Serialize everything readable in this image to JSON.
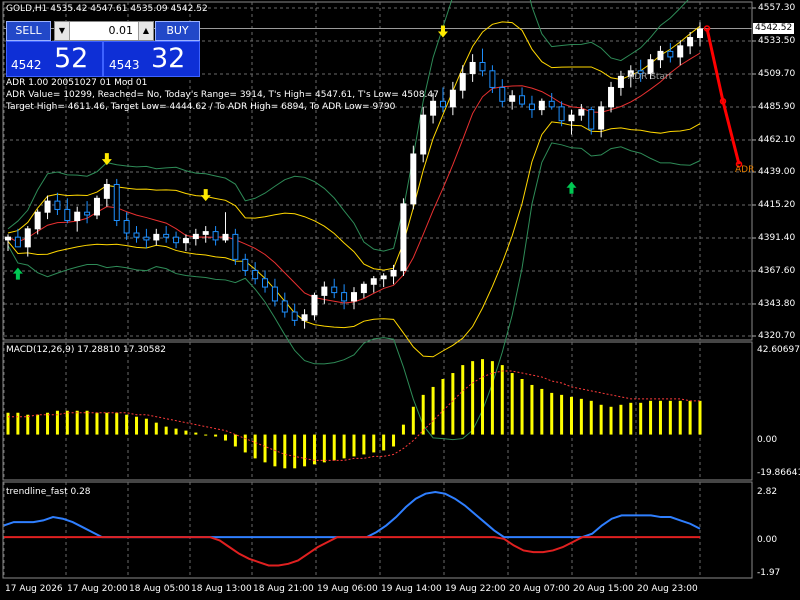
{
  "chart_header": "GOLD,H1  4535.42 4547.61 4535.09 4542.52",
  "trade_panel": {
    "sell_label": "SELL",
    "buy_label": "BUY",
    "lot": "0.01",
    "lot_down_icon": "arrow-down-icon",
    "lot_up_icon": "arrow-up-icon",
    "sell_small": "4542",
    "sell_big": "52",
    "buy_small": "4543",
    "buy_big": "32"
  },
  "adr_info": {
    "line1": "ADR 1.00 20051027 01 Mod 01",
    "line2": "ADR Value= 10299, Reached= No, Today's Range= 3914, T's High= 4547.61, T's Low= 4508.47",
    "line3": "Target High= 4611.46, Target Low= 4444.62 / To ADR High= 6894, To ADR Low= 9790"
  },
  "adr_labels": {
    "start": "ADR Start",
    "adr": "ADR"
  },
  "price_axis": {
    "ticks": [
      "4557.30",
      "4533.50",
      "4509.70",
      "4485.90",
      "4462.10",
      "4439.00",
      "4415.20",
      "4391.40",
      "4367.60",
      "4343.80",
      "4320.70"
    ],
    "current": "4542.52"
  },
  "macd": {
    "label": "MACD(12,26,9) 17.28810 17.30582",
    "ticks": [
      "42.60697",
      "0.00",
      "-19.86641"
    ]
  },
  "trendline": {
    "label": "trendline_fast 0.28",
    "ticks": [
      "2.82",
      "0.00",
      "-1.97"
    ]
  },
  "time_axis": [
    "17 Aug 2026",
    "17 Aug 20:00",
    "18 Aug 05:00",
    "18 Aug 13:00",
    "18 Aug 21:00",
    "19 Aug 06:00",
    "19 Aug 14:00",
    "19 Aug 22:00",
    "20 Aug 07:00",
    "20 Aug 15:00",
    "20 Aug 23:00"
  ],
  "colors": {
    "bull": "#ffffff",
    "bear": "#1e90ff",
    "macd_hist": "#ffff00",
    "macd_signal": "#ff3b3b",
    "bands": "#2e8b57",
    "inner_band": "#ffd700",
    "mid": "#e83030",
    "trend_blue": "#2f7fff",
    "trend_red": "#e02020",
    "adr_projection": "#ff0000",
    "grid": "#6a6a6a",
    "arrow_up": "#00c853",
    "arrow_down": "#ffea00"
  },
  "chart_data": {
    "type": "candlestick",
    "price_range": [
      4320.7,
      4557.3
    ],
    "last_price": 4542.52,
    "candles": [
      [
        4390,
        4394,
        4382,
        4392
      ],
      [
        4392,
        4398,
        4386,
        4385
      ],
      [
        4385,
        4400,
        4378,
        4398
      ],
      [
        4398,
        4412,
        4394,
        4410
      ],
      [
        4410,
        4422,
        4405,
        4418
      ],
      [
        4418,
        4424,
        4408,
        4412
      ],
      [
        4412,
        4420,
        4402,
        4404
      ],
      [
        4404,
        4414,
        4396,
        4410
      ],
      [
        4410,
        4418,
        4402,
        4408
      ],
      [
        4408,
        4422,
        4405,
        4420
      ],
      [
        4420,
        4434,
        4414,
        4430
      ],
      [
        4430,
        4434,
        4400,
        4404
      ],
      [
        4404,
        4410,
        4390,
        4395
      ],
      [
        4395,
        4400,
        4388,
        4392
      ],
      [
        4392,
        4398,
        4384,
        4390
      ],
      [
        4390,
        4398,
        4386,
        4394
      ],
      [
        4394,
        4400,
        4388,
        4392
      ],
      [
        4392,
        4396,
        4384,
        4388
      ],
      [
        4388,
        4394,
        4382,
        4391
      ],
      [
        4391,
        4398,
        4386,
        4394
      ],
      [
        4394,
        4400,
        4388,
        4396
      ],
      [
        4396,
        4400,
        4386,
        4390
      ],
      [
        4390,
        4410,
        4388,
        4394
      ],
      [
        4394,
        4398,
        4372,
        4376
      ],
      [
        4376,
        4380,
        4364,
        4368
      ],
      [
        4368,
        4374,
        4358,
        4362
      ],
      [
        4362,
        4368,
        4352,
        4356
      ],
      [
        4356,
        4362,
        4342,
        4346
      ],
      [
        4346,
        4352,
        4334,
        4338
      ],
      [
        4338,
        4344,
        4328,
        4332
      ],
      [
        4332,
        4340,
        4326,
        4336
      ],
      [
        4336,
        4352,
        4332,
        4350
      ],
      [
        4350,
        4360,
        4344,
        4356
      ],
      [
        4356,
        4362,
        4348,
        4352
      ],
      [
        4352,
        4358,
        4340,
        4346
      ],
      [
        4346,
        4356,
        4340,
        4352
      ],
      [
        4352,
        4360,
        4348,
        4358
      ],
      [
        4358,
        4364,
        4352,
        4362
      ],
      [
        4362,
        4366,
        4356,
        4364
      ],
      [
        4364,
        4372,
        4358,
        4368
      ],
      [
        4368,
        4420,
        4364,
        4416
      ],
      [
        4416,
        4458,
        4412,
        4452
      ],
      [
        4452,
        4486,
        4446,
        4480
      ],
      [
        4480,
        4496,
        4474,
        4490
      ],
      [
        4490,
        4500,
        4482,
        4486
      ],
      [
        4486,
        4504,
        4480,
        4498
      ],
      [
        4498,
        4516,
        4492,
        4510
      ],
      [
        4510,
        4524,
        4504,
        4518
      ],
      [
        4518,
        4528,
        4508,
        4512
      ],
      [
        4512,
        4516,
        4496,
        4500
      ],
      [
        4500,
        4506,
        4486,
        4490
      ],
      [
        4490,
        4498,
        4484,
        4494
      ],
      [
        4494,
        4500,
        4486,
        4488
      ],
      [
        4488,
        4494,
        4478,
        4484
      ],
      [
        4484,
        4492,
        4480,
        4490
      ],
      [
        4490,
        4496,
        4484,
        4486
      ],
      [
        4486,
        4490,
        4472,
        4476
      ],
      [
        4476,
        4484,
        4466,
        4480
      ],
      [
        4480,
        4488,
        4476,
        4484
      ],
      [
        4484,
        4486,
        4466,
        4470
      ],
      [
        4470,
        4490,
        4464,
        4486
      ],
      [
        4486,
        4504,
        4482,
        4500
      ],
      [
        4500,
        4512,
        4494,
        4508
      ],
      [
        4508,
        4516,
        4500,
        4512
      ],
      [
        4512,
        4520,
        4504,
        4510
      ],
      [
        4510,
        4524,
        4506,
        4520
      ],
      [
        4520,
        4530,
        4514,
        4526
      ],
      [
        4526,
        4532,
        4518,
        4522
      ],
      [
        4522,
        4534,
        4516,
        4530
      ],
      [
        4530,
        4540,
        4524,
        4536
      ],
      [
        4536,
        4547,
        4530,
        4542
      ]
    ],
    "adr_projection": [
      4542.52,
      4490,
      4444.62
    ],
    "macd": {
      "range": [
        -19.86641,
        42.60697
      ],
      "histogram": [
        11,
        11,
        10,
        10,
        11,
        12,
        12,
        12,
        12,
        11,
        11,
        11,
        10,
        9,
        8,
        6,
        4,
        3,
        2,
        1,
        0,
        -1,
        -3,
        -6,
        -9,
        -12,
        -14,
        -16,
        -17,
        -17,
        -16,
        -15,
        -14,
        -13,
        -12,
        -11,
        -10,
        -9,
        -8,
        -6,
        5,
        14,
        20,
        24,
        28,
        31,
        35,
        37,
        38,
        37,
        35,
        31,
        28,
        25,
        23,
        21,
        20,
        19,
        18,
        17,
        15,
        14,
        15,
        16,
        16,
        17,
        17,
        17,
        17,
        17,
        17
      ],
      "signal": [
        9,
        9,
        9,
        10,
        10,
        10,
        11,
        11,
        11,
        11,
        11,
        11,
        11,
        10,
        10,
        9,
        8,
        7,
        6,
        5,
        4,
        3,
        2,
        0,
        -2,
        -4,
        -6,
        -8,
        -10,
        -11,
        -12,
        -13,
        -13,
        -13,
        -13,
        -12,
        -12,
        -11,
        -11,
        -10,
        -7,
        -3,
        2,
        7,
        12,
        17,
        22,
        26,
        29,
        31,
        32,
        32,
        31,
        30,
        29,
        27,
        26,
        24,
        23,
        22,
        21,
        20,
        19,
        18,
        18,
        18,
        18,
        18,
        18,
        17,
        17
      ]
    },
    "trend_fast": {
      "range": [
        -1.97,
        2.82
      ],
      "values": [
        0.7,
        0.9,
        0.9,
        0.9,
        1.0,
        1.2,
        1.1,
        0.9,
        0.6,
        0.3,
        0.0,
        0.0,
        0.0,
        0.0,
        0.0,
        0.0,
        0.0,
        0.0,
        0.0,
        0.0,
        0.0,
        0.0,
        -0.2,
        -0.6,
        -1.0,
        -1.3,
        -1.5,
        -1.7,
        -1.7,
        -1.6,
        -1.4,
        -1.0,
        -0.6,
        -0.3,
        0.0,
        0.0,
        0.0,
        0.0,
        0.3,
        0.7,
        1.2,
        1.8,
        2.3,
        2.6,
        2.7,
        2.6,
        2.3,
        1.9,
        1.4,
        0.9,
        0.4,
        -0.1,
        -0.5,
        -0.8,
        -0.9,
        -0.9,
        -0.8,
        -0.6,
        -0.3,
        0.0,
        0.2,
        0.7,
        1.1,
        1.3,
        1.3,
        1.3,
        1.3,
        1.2,
        1.2,
        1.0,
        0.8,
        0.5
      ]
    }
  }
}
